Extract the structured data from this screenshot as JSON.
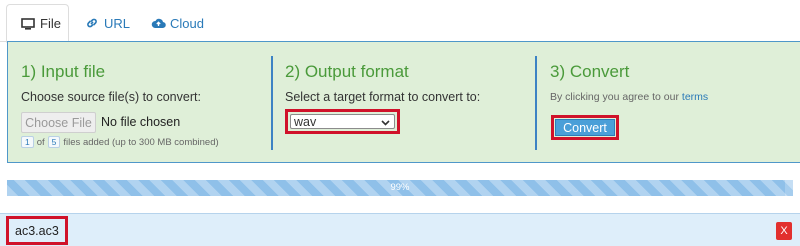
{
  "tabs": [
    {
      "label": "File",
      "icon": "monitor-icon",
      "active": true
    },
    {
      "label": "URL",
      "icon": "link-icon",
      "active": false
    },
    {
      "label": "Cloud",
      "icon": "cloud-upload-icon",
      "active": false
    }
  ],
  "input": {
    "title": "1) Input file",
    "desc": "Choose source file(s) to convert:",
    "choose_label": "Choose File",
    "no_file": "No file chosen",
    "count_current": "1",
    "count_of": "of",
    "count_max": "5",
    "count_suffix": "files added (up to 300 MB combined)"
  },
  "output": {
    "title": "2) Output format",
    "desc": "Select a target format to convert to:",
    "selected": "wav"
  },
  "convert": {
    "title": "3) Convert",
    "terms_prefix": "By clicking you agree to our",
    "terms_link": "terms",
    "button": "Convert"
  },
  "progress": {
    "value": 99,
    "label": "99%"
  },
  "file": {
    "name": "ac3.ac3",
    "remove_label": "X"
  },
  "colors": {
    "accent": "#2a7ab8",
    "panel_bg": "#dfefd8",
    "heading_green": "#4a9a3a",
    "highlight": "#d0122a",
    "remove": "#e2302e"
  }
}
